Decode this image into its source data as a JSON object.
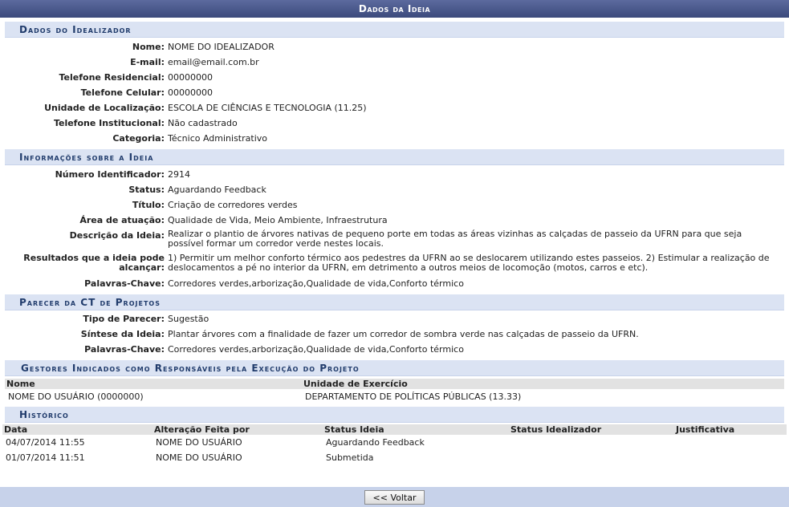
{
  "window_title": "Dados da Ideia",
  "idealizador": {
    "title": "Dados do Idealizador",
    "fields": [
      {
        "label": "Nome:",
        "value": "NOME DO IDEALIZADOR"
      },
      {
        "label": "E-mail:",
        "value": "email@email.com.br"
      },
      {
        "label": "Telefone Residencial:",
        "value": "00000000"
      },
      {
        "label": "Telefone Celular:",
        "value": "00000000"
      },
      {
        "label": "Unidade de Localização:",
        "value": "ESCOLA DE CIÊNCIAS E TECNOLOGIA (11.25)"
      },
      {
        "label": "Telefone Institucional:",
        "value": "Não cadastrado"
      },
      {
        "label": "Categoria:",
        "value": "Técnico Administrativo"
      }
    ]
  },
  "ideia": {
    "title": "Informações sobre a Ideia",
    "fields": [
      {
        "label": "Número Identificador:",
        "value": "2914"
      },
      {
        "label": "Status:",
        "value": "Aguardando Feedback"
      },
      {
        "label": "Título:",
        "value": "Criação de corredores verdes"
      },
      {
        "label": "Área de atuação:",
        "value": "Qualidade de Vida, Meio Ambiente, Infraestrutura"
      },
      {
        "label": "Descrição da Ideia:",
        "value": "Realizar o plantio de árvores nativas de pequeno porte em todas as áreas vizinhas as calçadas de passeio da UFRN para que seja possível formar um corredor verde nestes locais."
      },
      {
        "label": "Resultados que a ideia pode alcançar:",
        "value": "1) Permitir um melhor conforto térmico aos pedestres da UFRN ao se deslocarem utilizando estes passeios. 2) Estimular a realização de deslocamentos a pé no interior da UFRN, em detrimento a outros meios de locomoção (motos, carros e etc)."
      },
      {
        "label": "Palavras-Chave:",
        "value": "Corredores verdes,arborização,Qualidade de vida,Conforto térmico"
      }
    ]
  },
  "parecer": {
    "title": "Parecer da CT de Projetos",
    "fields": [
      {
        "label": "Tipo de Parecer:",
        "value": "Sugestão"
      },
      {
        "label": "Síntese da Ideia:",
        "value": "Plantar árvores com a finalidade de fazer um corredor de sombra verde nas calçadas de passeio da UFRN."
      },
      {
        "label": "Palavras-Chave:",
        "value": "Corredores verdes,arborização,Qualidade de vida,Conforto térmico"
      }
    ]
  },
  "gestores": {
    "title": "Gestores Indicados como Responsáveis pela Execução do Projeto",
    "headers": [
      "Nome",
      "Unidade de Exercício"
    ],
    "rows": [
      [
        "NOME DO USUÁRIO (0000000)",
        "DEPARTAMENTO DE POLÍTICAS PÚBLICAS (13.33)"
      ]
    ]
  },
  "historico": {
    "title": "Histórico",
    "headers": [
      "Data",
      "Alteração Feita por",
      "Status Ideia",
      "Status Idealizador",
      "Justificativa"
    ],
    "rows": [
      [
        "04/07/2014 11:55",
        "NOME DO USUÁRIO",
        "Aguardando Feedback",
        "",
        ""
      ],
      [
        "01/07/2014 11:51",
        "NOME DO USUÁRIO",
        "Submetida",
        "",
        ""
      ]
    ]
  },
  "footer": {
    "back_label": "<< Voltar"
  }
}
